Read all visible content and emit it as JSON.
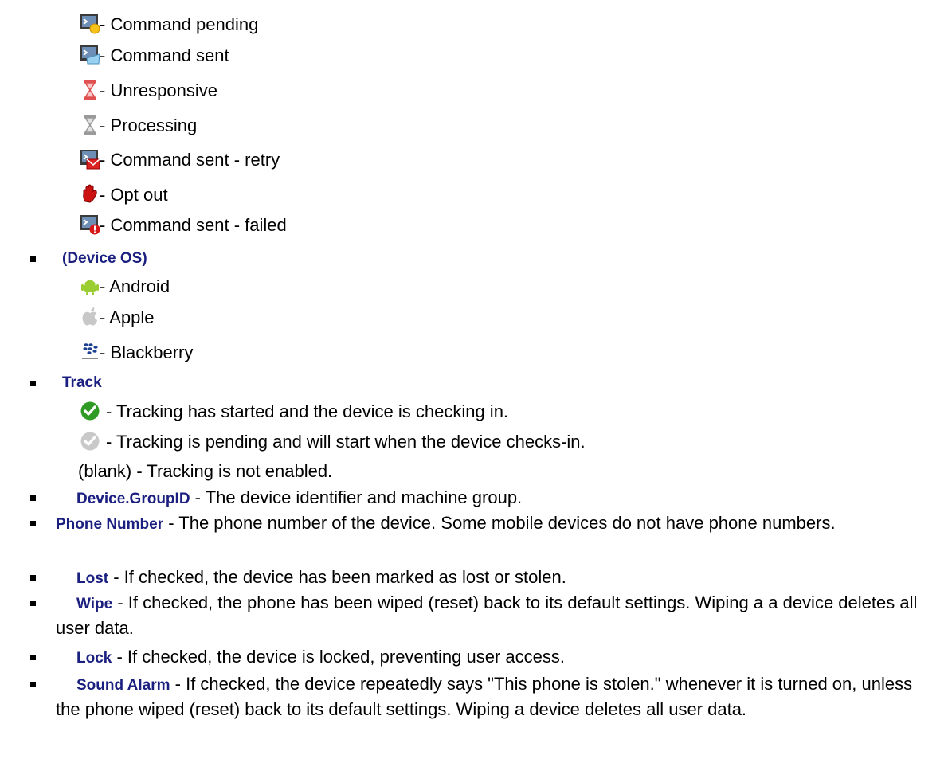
{
  "status_icons": [
    {
      "label": " - Command pending",
      "icon": "command-pending-icon"
    },
    {
      "label": " - Command sent",
      "icon": "command-sent-icon"
    },
    {
      "label": " - Unresponsive",
      "icon": "hourglass-red-icon"
    },
    {
      "label": " - Processing",
      "icon": "hourglass-gray-icon"
    },
    {
      "label": " - Command sent - retry",
      "icon": "command-retry-icon"
    },
    {
      "label": " - Opt out",
      "icon": "stop-hand-icon"
    },
    {
      "label": " - Command sent - failed",
      "icon": "command-failed-icon"
    }
  ],
  "device_os": {
    "term": "(Device OS)",
    "items": [
      {
        "label": " - Android",
        "icon": "android-icon"
      },
      {
        "label": " - Apple",
        "icon": "apple-icon"
      },
      {
        "label": " - Blackberry",
        "icon": "blackberry-icon"
      }
    ]
  },
  "track": {
    "term": "Track",
    "items": [
      {
        "label": " - Tracking has started and the device is checking in.",
        "icon": "check-green-icon"
      },
      {
        "label": " -   Tracking is pending and will start when the device checks-in.",
        "icon": "check-gray-icon"
      }
    ],
    "blank_note": "(blank) - Tracking is not enabled."
  },
  "fields": [
    {
      "term": "Device.GroupID",
      "desc": " - The device identifier and machine group."
    },
    {
      "term": "Phone Number",
      "desc": " - The phone number of the device. Some mobile devices do not have phone numbers."
    },
    {
      "term": "Lost",
      "desc": " - If checked, the device has been marked as lost or stolen."
    },
    {
      "term": "Wipe",
      "desc": " - If checked, the phone has been wiped (reset) back to its default settings. Wiping a a device deletes all user data."
    },
    {
      "term": "Lock",
      "desc": " - If checked, the device is locked, preventing user access."
    },
    {
      "term": "Sound Alarm",
      "desc": " - If checked, the device repeatedly says \"This phone is stolen.\" whenever it is turned on, unless the phone wiped (reset) back to its default settings. Wiping a device deletes all user data."
    }
  ],
  "colors": {
    "term": "#1a1f80",
    "bullet": "#000000"
  }
}
